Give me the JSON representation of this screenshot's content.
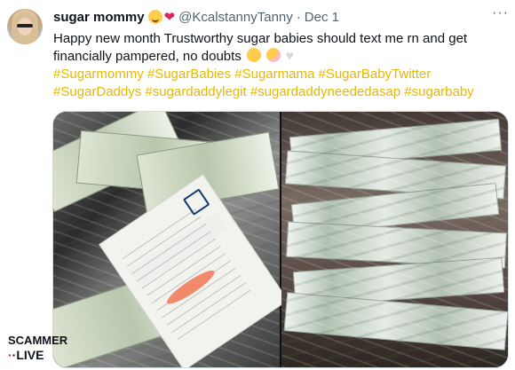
{
  "tweet": {
    "author_name": "sugar mommy",
    "handle": "@KcalstannyTanny",
    "separator": "·",
    "date": "Dec 1",
    "more_label": "···",
    "text_line_1": "Happy new month Trustworthy sugar babies should text me rn and get",
    "text_line_2": "financially pampered, no doubts",
    "hashtags_line_1": "#Sugarmommy #SugarBabies #Sugarmama #SugarBabyTwitter",
    "hashtags_line_2": "#SugarDaddys #sugardaddylegit #sugardaddyneededasap #sugarbaby",
    "icons": {
      "avatar": "profile-photo-icon",
      "emoji_1": "smiling-face-with-hearts-icon",
      "emoji_2": "red-heart-icon",
      "emoji_3": "smiling-face-with-hearts-icon",
      "emoji_4": "kissing-face-icon",
      "emoji_5": "white-heart-icon"
    },
    "colors": {
      "hashtag": "#e8b800",
      "meta": "#536471",
      "text": "#0f1419"
    }
  },
  "media": {
    "left_image": "bank-card-and-cash-photo",
    "right_image": "stack-of-hundred-dollar-bills-photo"
  },
  "watermark": {
    "line_1": "SCAMMER",
    "line_2": "·LIVE"
  }
}
